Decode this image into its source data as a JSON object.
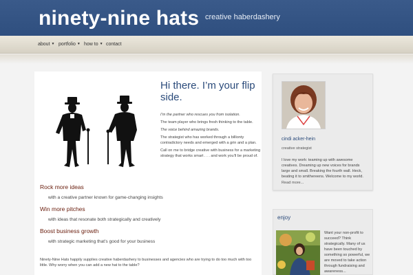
{
  "header": {
    "site_title": "ninety-nine hats",
    "tagline": "creative haberdashery"
  },
  "nav": {
    "items": [
      {
        "label": "about",
        "has_caret": true
      },
      {
        "label": "portfolio",
        "has_caret": true
      },
      {
        "label": "how to",
        "has_caret": true
      },
      {
        "label": "contact",
        "has_caret": false
      }
    ],
    "caret": "▼"
  },
  "main": {
    "image_icon": "two-gentlemen-in-top-hats-silhouette",
    "headline": "Hi there. I’m your flip side.",
    "intro": [
      "I’m the partner who rescues you from isolation.",
      "The team player who brings fresh thinking to the table.",
      "The voice behind amazing brands.",
      "The strategist who has worked through a billionty contradictory needs and emerged with a grin and a plan.",
      "Call on me to bridge creative with business for a marketing strategy that works smart . . . and work you’ll be proud of."
    ],
    "sections": [
      {
        "heading": "Rock more ideas",
        "text": "with a creative partner known for game-changing insights"
      },
      {
        "heading": "Win more pitches",
        "text": "with ideas that resonate both strategically and creatively"
      },
      {
        "heading": "Boost business growth",
        "text": "with strategic marketing that’s good for your business"
      }
    ],
    "footer_text": "Ninety-Nine Hats happily supplies creative haberdashery to businesses and agencies who are trying to do too much with too little. Why worry when you can add a new hat to the table?"
  },
  "sidebar": {
    "profile": {
      "name": "cindi acker-hein",
      "role": "creative strategist",
      "bio": "I love my work: teaming up with awesome creatives. Dreaming up new voices for brands large and small. Breaking the fourth wall. Heck, beating it to smithereens. Welcome to my world.",
      "read_more": "Read more..."
    },
    "enjoy": {
      "title": "enjoy",
      "text": "Want your non-profit to succeed? Think strategically. Many of us have been touched by something so powerful, we are moved to take action through fundraising and awareness..."
    }
  },
  "colors": {
    "header_bg": "#355584",
    "title": "#ffffff",
    "headline": "#2a4a7a",
    "section_heading": "#6b2010"
  }
}
